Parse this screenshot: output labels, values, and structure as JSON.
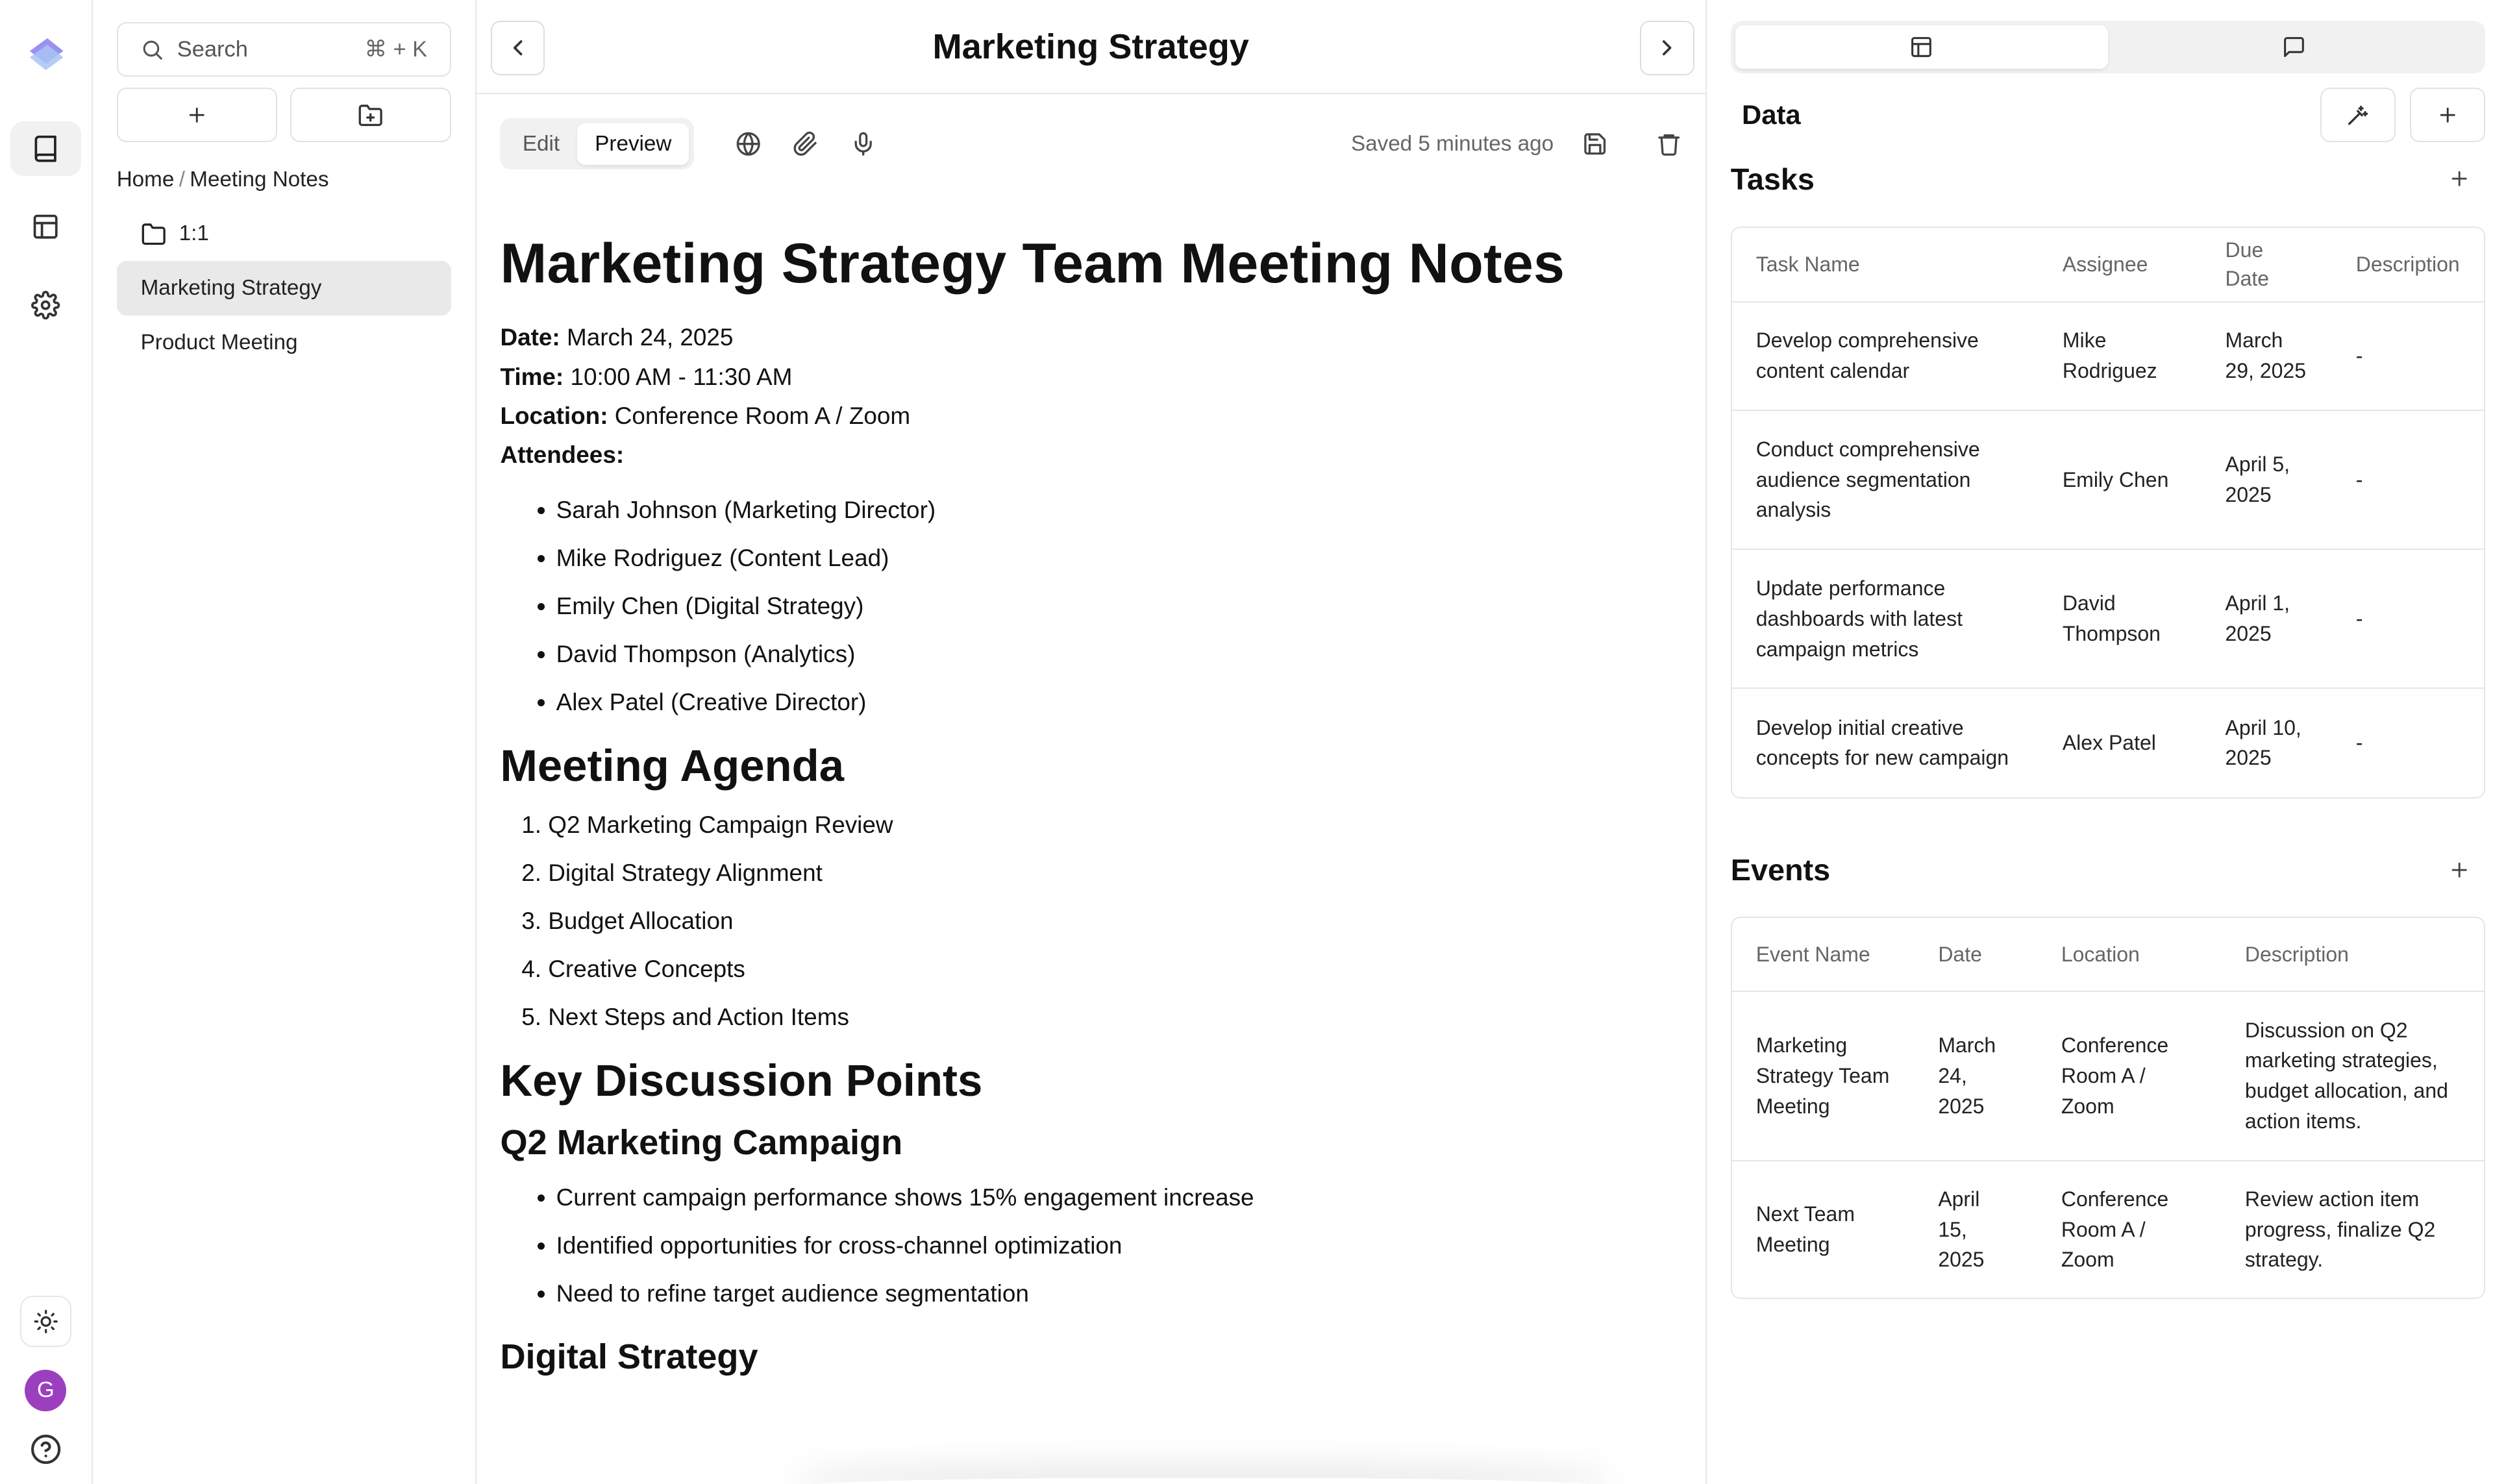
{
  "rail": {
    "icons": [
      "logo-icon",
      "book-icon",
      "table-icon",
      "gear-icon",
      "sun-icon",
      "help-icon"
    ],
    "avatar_initial": "G",
    "avatar_color": "#9b3fbf"
  },
  "files": {
    "search_placeholder": "Search",
    "search_shortcut": "⌘ + K",
    "breadcrumb": [
      "Home",
      "Meeting Notes"
    ],
    "breadcrumb_sep": "/",
    "folder": "1:1",
    "items": [
      "Marketing Strategy",
      "Product Meeting"
    ]
  },
  "editor": {
    "title": "Marketing Strategy",
    "mode_edit": "Edit",
    "mode_preview": "Preview",
    "saved_text": "Saved 5 minutes ago"
  },
  "doc": {
    "h1": "Marketing Strategy Team Meeting Notes",
    "date_label": "Date:",
    "date": " March 24, 2025",
    "time_label": "Time:",
    "time": " 10:00 AM - 11:30 AM",
    "location_label": "Location:",
    "location": " Conference Room A / Zoom",
    "attendees_label": "Attendees:",
    "attendees": [
      "Sarah Johnson (Marketing Director)",
      "Mike Rodriguez (Content Lead)",
      "Emily Chen (Digital Strategy)",
      "David Thompson (Analytics)",
      "Alex Patel (Creative Director)"
    ],
    "agenda_title": "Meeting Agenda",
    "agenda": [
      "Q2 Marketing Campaign Review",
      "Digital Strategy Alignment",
      "Budget Allocation",
      "Creative Concepts",
      "Next Steps and Action Items"
    ],
    "discussion_title": "Key Discussion Points",
    "q2_title": "Q2 Marketing Campaign",
    "q2_points": [
      "Current campaign performance shows 15% engagement increase",
      "Identified opportunities for cross-channel optimization",
      "Need to refine target audience segmentation"
    ],
    "digital_title": "Digital Strategy"
  },
  "data_panel": {
    "title": "Data",
    "tasks_title": "Tasks",
    "tasks_headers": [
      "Task Name",
      "Assignee",
      "Due Date",
      "Description"
    ],
    "tasks": [
      [
        "Develop comprehensive content calendar",
        "Mike Rodriguez",
        "March 29, 2025",
        "-"
      ],
      [
        "Conduct comprehensive audience segmentation analysis",
        "Emily Chen",
        "April 5, 2025",
        "-"
      ],
      [
        "Update performance dashboards with latest campaign metrics",
        "David Thompson",
        "April 1, 2025",
        "-"
      ],
      [
        "Develop initial creative concepts for new campaign",
        "Alex Patel",
        "April 10, 2025",
        "-"
      ]
    ],
    "events_title": "Events",
    "events_headers": [
      "Event Name",
      "Date",
      "Location",
      "Description"
    ],
    "events": [
      [
        "Marketing Strategy Team Meeting",
        "March 24, 2025",
        "Conference Room A / Zoom",
        "Discussion on Q2 marketing strategies, budget allocation, and action items."
      ],
      [
        "Next Team Meeting",
        "April 15, 2025",
        "Conference Room A / Zoom",
        "Review action item progress, finalize Q2 strategy."
      ]
    ]
  }
}
